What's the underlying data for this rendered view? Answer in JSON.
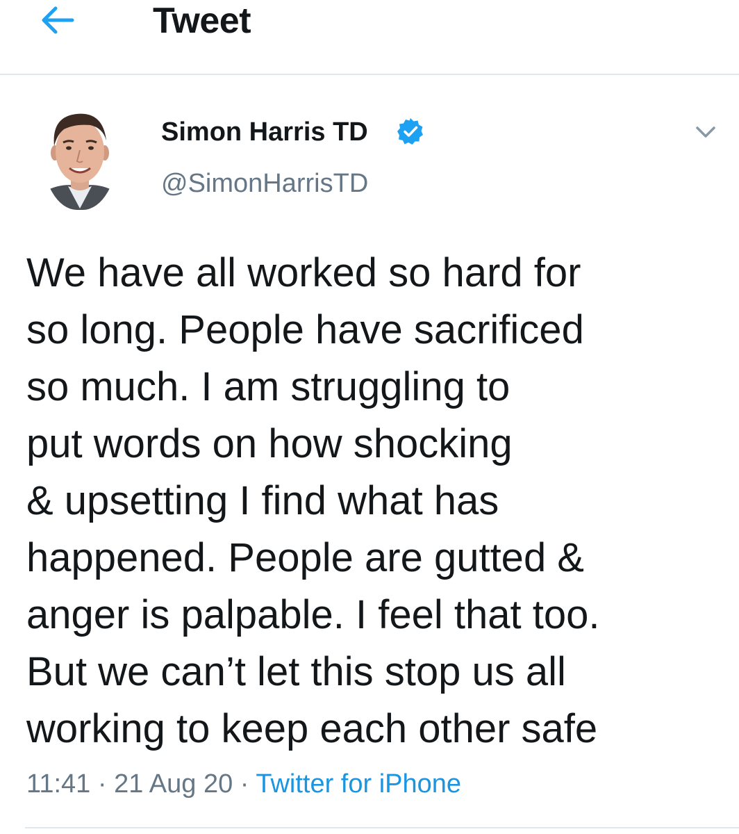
{
  "header": {
    "title": "Tweet",
    "back_icon": "arrow-left-icon"
  },
  "tweet": {
    "author": {
      "name": "Simon Harris TD",
      "handle": "@SimonHarrisTD",
      "verified": true,
      "avatar_icon": "profile-photo"
    },
    "text": "We have all worked so hard for\nso long. People have sacrificed\nso much. I am struggling to\nput words on how shocking\n& upsetting I find what has\nhappened. People are gutted &\nanger is palpable. I feel that too.\nBut we can’t let this stop us all\nworking to keep each other safe",
    "time": "11:41",
    "date": "21 Aug 20",
    "separator": " · ",
    "source": "Twitter for iPhone",
    "menu_icon": "chevron-down-icon"
  },
  "colors": {
    "accent": "#1da1f2",
    "link": "#1b95e0",
    "text": "#14171a",
    "secondary_text": "#657786",
    "divider": "#e1e8ed"
  }
}
